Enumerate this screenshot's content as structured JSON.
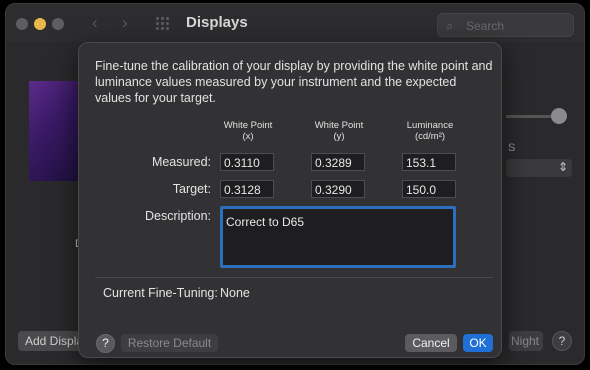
{
  "window": {
    "title": "Displays"
  },
  "toolbar": {
    "back_glyph": "‹",
    "forward_glyph": "›",
    "search_placeholder": "Search",
    "search_icon": "magnifier"
  },
  "background": {
    "display_label_fragment": "D",
    "slider_side_label": "S",
    "add_display_label": "Add Display",
    "night_shift_label": "Night Shift...",
    "help_label": "?"
  },
  "sheet": {
    "intro": "Fine-tune the calibration of your display by providing the white point and luminance values measured by your instrument and the expected values for your target.",
    "columns": [
      {
        "title": "White Point",
        "unit": "(x)"
      },
      {
        "title": "White Point",
        "unit": "(y)"
      },
      {
        "title": "Luminance",
        "unit": "(cd/m²)"
      }
    ],
    "measured": {
      "label": "Measured:",
      "values": [
        "0.3110",
        "0.3289",
        "153.1"
      ]
    },
    "target": {
      "label": "Target:",
      "values": [
        "0.3128",
        "0.3290",
        "150.0"
      ]
    },
    "description": {
      "label": "Description:",
      "value": "Correct to D65"
    },
    "current": {
      "label": "Current Fine-Tuning:",
      "value": "None"
    },
    "buttons": {
      "help": "?",
      "restore": "Restore Default",
      "cancel": "Cancel",
      "ok": "OK"
    }
  },
  "colors": {
    "accent": "#1f6fd6",
    "focus_ring": "#2d6fbd",
    "sheet_bg": "#323234"
  }
}
